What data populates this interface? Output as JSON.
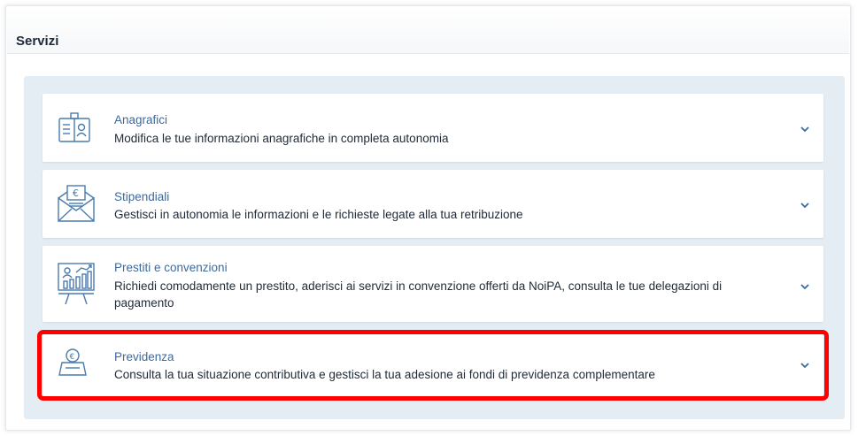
{
  "header": {
    "title": "Servizi"
  },
  "services": [
    {
      "title": "Anagrafici",
      "description": "Modifica le tue informazioni anagrafiche in completa autonomia",
      "icon": "id-card-icon"
    },
    {
      "title": "Stipendiali",
      "description": "Gestisci in autonomia le informazioni e le richieste legate alla tua retribuzione",
      "icon": "envelope-euro-icon"
    },
    {
      "title": "Prestiti e convenzioni",
      "description": "Richiedi comodamente un prestito, aderisci ai servizi in convenzione offerti da NoiPA, consulta le tue delegazioni di pagamento",
      "icon": "presentation-chart-icon"
    },
    {
      "title": "Previdenza",
      "description": "Consulta la tua situazione contributiva e gestisci la tua adesione ai fondi di previdenza complementare",
      "icon": "piggy-bank-euro-icon",
      "highlighted": true
    }
  ],
  "colors": {
    "title": "#3d6a9c",
    "icon": "#4a7bb0",
    "panel": "#e4ecf4",
    "highlight": "#ff0000"
  }
}
